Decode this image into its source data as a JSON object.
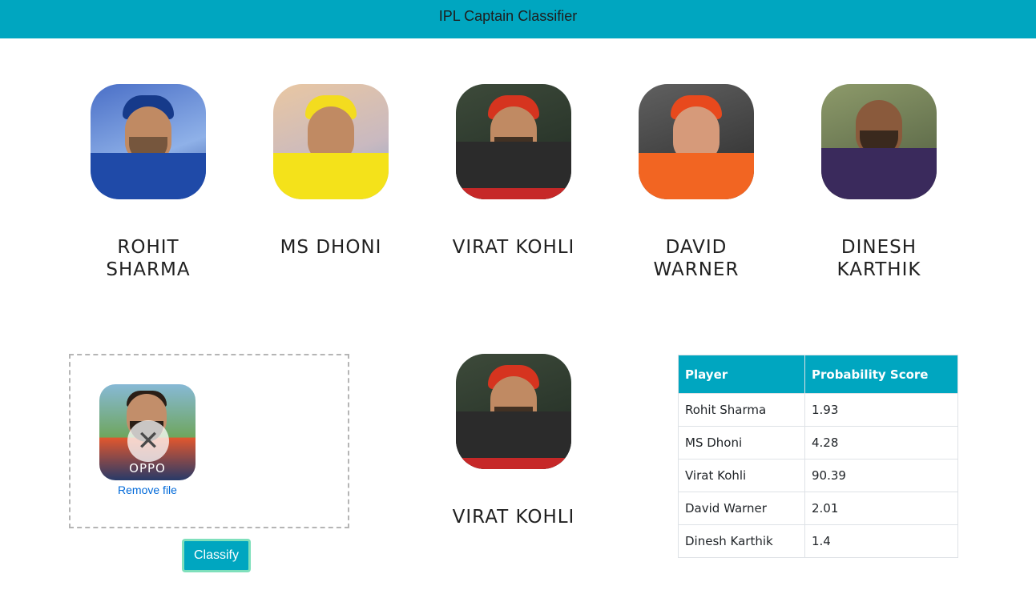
{
  "navbar": {
    "title": "IPL Captain Classifier"
  },
  "players": [
    {
      "name_line1": "ROHIT",
      "name_line2": "SHARMA",
      "avatar_icon": "rohit-sharma-photo",
      "jersey_color": "#1f4aa8",
      "cap_color": "#163a8a"
    },
    {
      "name_line1": "MS DHONI",
      "name_line2": "",
      "avatar_icon": "ms-dhoni-photo",
      "jersey_color": "#f4e21a",
      "cap_color": "#f3dc1f"
    },
    {
      "name_line1": "VIRAT KOHLI",
      "name_line2": "",
      "avatar_icon": "virat-kohli-photo",
      "jersey_color": "#2b2b2b",
      "cap_color": "#d6341f"
    },
    {
      "name_line1": "DAVID",
      "name_line2": "WARNER",
      "avatar_icon": "david-warner-photo",
      "jersey_color": "#f26522",
      "cap_color": "#e8491d"
    },
    {
      "name_line1": "DINESH",
      "name_line2": "KARTHIK",
      "avatar_icon": "dinesh-karthik-photo",
      "jersey_color": "#3a2a5c",
      "cap_color": ""
    }
  ],
  "upload": {
    "preview_icon": "uploaded-virat-kohli-photo",
    "preview_brand": "OPPO",
    "remove_icon": "close-x-icon",
    "remove_label": "Remove file"
  },
  "classify": {
    "button_label": "Classify"
  },
  "result": {
    "name": "VIRAT KOHLI",
    "avatar_icon": "virat-kohli-photo"
  },
  "scores_table": {
    "headers": [
      "Player",
      "Probability Score"
    ],
    "rows": [
      [
        "Rohit Sharma",
        "1.93"
      ],
      [
        "MS Dhoni",
        "4.28"
      ],
      [
        "Virat Kohli",
        "90.39"
      ],
      [
        "David Warner",
        "2.01"
      ],
      [
        "Dinesh Karthik",
        "1.4"
      ]
    ]
  },
  "colors": {
    "accent": "#00a6c0",
    "button_border": "#7fe0bc",
    "link": "#0069d9"
  }
}
